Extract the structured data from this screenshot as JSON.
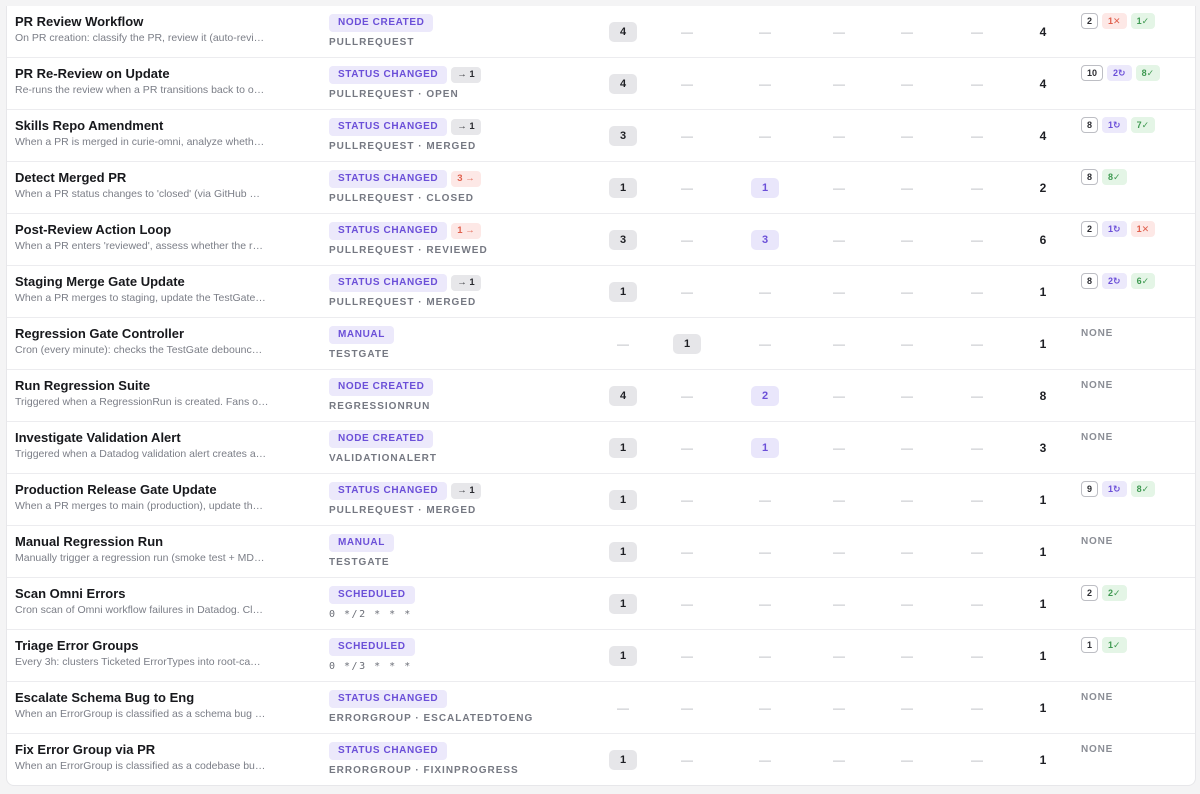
{
  "dash": "—",
  "none_label": "NONE",
  "workflows": [
    {
      "name": "PR Review Workflow",
      "desc": "On PR creation: classify the PR, review it (auto-revi…",
      "trigger": "NODE CREATED",
      "transition": "",
      "transition_style": "",
      "scope": "PULLREQUEST",
      "scope_mono": false,
      "counts": [
        {
          "v": "4",
          "s": "gray"
        },
        {
          "v": "—",
          "s": "dash"
        },
        {
          "v": "—",
          "s": "dash"
        },
        {
          "v": "—",
          "s": "dash"
        },
        {
          "v": "—",
          "s": "dash"
        },
        {
          "v": "—",
          "s": "dash"
        }
      ],
      "total": "4",
      "runs": [
        {
          "t": "2",
          "k": "count"
        },
        {
          "t": "1✕",
          "k": "red"
        },
        {
          "t": "1✓",
          "k": "green"
        }
      ]
    },
    {
      "name": "PR Re-Review on Update",
      "desc": "Re-runs the review when a PR transitions back to o…",
      "trigger": "STATUS CHANGED",
      "transition": "→ 1",
      "transition_style": "",
      "scope": "PULLREQUEST · OPEN",
      "scope_mono": false,
      "counts": [
        {
          "v": "4",
          "s": "gray"
        },
        {
          "v": "—",
          "s": "dash"
        },
        {
          "v": "—",
          "s": "dash"
        },
        {
          "v": "—",
          "s": "dash"
        },
        {
          "v": "—",
          "s": "dash"
        },
        {
          "v": "—",
          "s": "dash"
        }
      ],
      "total": "4",
      "runs": [
        {
          "t": "10",
          "k": "count"
        },
        {
          "t": "2↻",
          "k": "purple"
        },
        {
          "t": "8✓",
          "k": "green"
        }
      ]
    },
    {
      "name": "Skills Repo Amendment",
      "desc": "When a PR is merged in curie-omni, analyze wheth…",
      "trigger": "STATUS CHANGED",
      "transition": "→ 1",
      "transition_style": "",
      "scope": "PULLREQUEST · MERGED",
      "scope_mono": false,
      "counts": [
        {
          "v": "3",
          "s": "gray"
        },
        {
          "v": "—",
          "s": "dash"
        },
        {
          "v": "—",
          "s": "dash"
        },
        {
          "v": "—",
          "s": "dash"
        },
        {
          "v": "—",
          "s": "dash"
        },
        {
          "v": "—",
          "s": "dash"
        }
      ],
      "total": "4",
      "runs": [
        {
          "t": "8",
          "k": "count"
        },
        {
          "t": "1↻",
          "k": "purple"
        },
        {
          "t": "7✓",
          "k": "green"
        }
      ]
    },
    {
      "name": "Detect Merged PR",
      "desc": "When a PR status changes to 'closed' (via GitHub …",
      "trigger": "STATUS CHANGED",
      "transition": "3 →",
      "transition_style": "warn",
      "scope": "PULLREQUEST · CLOSED",
      "scope_mono": false,
      "counts": [
        {
          "v": "1",
          "s": "gray"
        },
        {
          "v": "—",
          "s": "dash"
        },
        {
          "v": "1",
          "s": "purple"
        },
        {
          "v": "—",
          "s": "dash"
        },
        {
          "v": "—",
          "s": "dash"
        },
        {
          "v": "—",
          "s": "dash"
        }
      ],
      "total": "2",
      "runs": [
        {
          "t": "8",
          "k": "count"
        },
        {
          "t": "8✓",
          "k": "green"
        }
      ]
    },
    {
      "name": "Post-Review Action Loop",
      "desc": "When a PR enters 'reviewed', assess whether the r…",
      "trigger": "STATUS CHANGED",
      "transition": "1 →",
      "transition_style": "warn",
      "scope": "PULLREQUEST · REVIEWED",
      "scope_mono": false,
      "counts": [
        {
          "v": "3",
          "s": "gray"
        },
        {
          "v": "—",
          "s": "dash"
        },
        {
          "v": "3",
          "s": "purple"
        },
        {
          "v": "—",
          "s": "dash"
        },
        {
          "v": "—",
          "s": "dash"
        },
        {
          "v": "—",
          "s": "dash"
        }
      ],
      "total": "6",
      "runs": [
        {
          "t": "2",
          "k": "count"
        },
        {
          "t": "1↻",
          "k": "purple"
        },
        {
          "t": "1✕",
          "k": "red"
        }
      ]
    },
    {
      "name": "Staging Merge Gate Update",
      "desc": "When a PR merges to staging, update the TestGate…",
      "trigger": "STATUS CHANGED",
      "transition": "→ 1",
      "transition_style": "",
      "scope": "PULLREQUEST · MERGED",
      "scope_mono": false,
      "counts": [
        {
          "v": "1",
          "s": "gray"
        },
        {
          "v": "—",
          "s": "dash"
        },
        {
          "v": "—",
          "s": "dash"
        },
        {
          "v": "—",
          "s": "dash"
        },
        {
          "v": "—",
          "s": "dash"
        },
        {
          "v": "—",
          "s": "dash"
        }
      ],
      "total": "1",
      "runs": [
        {
          "t": "8",
          "k": "count"
        },
        {
          "t": "2↻",
          "k": "purple"
        },
        {
          "t": "6✓",
          "k": "green"
        }
      ]
    },
    {
      "name": "Regression Gate Controller",
      "desc": "Cron (every minute): checks the TestGate debounc…",
      "trigger": "MANUAL",
      "transition": "",
      "transition_style": "",
      "scope": "TESTGATE",
      "scope_mono": false,
      "counts": [
        {
          "v": "—",
          "s": "dash"
        },
        {
          "v": "1",
          "s": "gray"
        },
        {
          "v": "—",
          "s": "dash"
        },
        {
          "v": "—",
          "s": "dash"
        },
        {
          "v": "—",
          "s": "dash"
        },
        {
          "v": "—",
          "s": "dash"
        }
      ],
      "total": "1",
      "runs": []
    },
    {
      "name": "Run Regression Suite",
      "desc": "Triggered when a RegressionRun is created. Fans o…",
      "trigger": "NODE CREATED",
      "transition": "",
      "transition_style": "",
      "scope": "REGRESSIONRUN",
      "scope_mono": false,
      "counts": [
        {
          "v": "4",
          "s": "gray"
        },
        {
          "v": "—",
          "s": "dash"
        },
        {
          "v": "2",
          "s": "purple"
        },
        {
          "v": "—",
          "s": "dash"
        },
        {
          "v": "—",
          "s": "dash"
        },
        {
          "v": "—",
          "s": "dash"
        }
      ],
      "total": "8",
      "runs": []
    },
    {
      "name": "Investigate Validation Alert",
      "desc": "Triggered when a Datadog validation alert creates a…",
      "trigger": "NODE CREATED",
      "transition": "",
      "transition_style": "",
      "scope": "VALIDATIONALERT",
      "scope_mono": false,
      "counts": [
        {
          "v": "1",
          "s": "gray"
        },
        {
          "v": "—",
          "s": "dash"
        },
        {
          "v": "1",
          "s": "purple"
        },
        {
          "v": "—",
          "s": "dash"
        },
        {
          "v": "—",
          "s": "dash"
        },
        {
          "v": "—",
          "s": "dash"
        }
      ],
      "total": "3",
      "runs": []
    },
    {
      "name": "Production Release Gate Update",
      "desc": "When a PR merges to main (production), update th…",
      "trigger": "STATUS CHANGED",
      "transition": "→ 1",
      "transition_style": "",
      "scope": "PULLREQUEST · MERGED",
      "scope_mono": false,
      "counts": [
        {
          "v": "1",
          "s": "gray"
        },
        {
          "v": "—",
          "s": "dash"
        },
        {
          "v": "—",
          "s": "dash"
        },
        {
          "v": "—",
          "s": "dash"
        },
        {
          "v": "—",
          "s": "dash"
        },
        {
          "v": "—",
          "s": "dash"
        }
      ],
      "total": "1",
      "runs": [
        {
          "t": "9",
          "k": "count"
        },
        {
          "t": "1↻",
          "k": "purple"
        },
        {
          "t": "8✓",
          "k": "green"
        }
      ]
    },
    {
      "name": "Manual Regression Run",
      "desc": "Manually trigger a regression run (smoke test + MD…",
      "trigger": "MANUAL",
      "transition": "",
      "transition_style": "",
      "scope": "TESTGATE",
      "scope_mono": false,
      "counts": [
        {
          "v": "1",
          "s": "gray"
        },
        {
          "v": "—",
          "s": "dash"
        },
        {
          "v": "—",
          "s": "dash"
        },
        {
          "v": "—",
          "s": "dash"
        },
        {
          "v": "—",
          "s": "dash"
        },
        {
          "v": "—",
          "s": "dash"
        }
      ],
      "total": "1",
      "runs": []
    },
    {
      "name": "Scan Omni Errors",
      "desc": "Cron scan of Omni workflow failures in Datadog. Cl…",
      "trigger": "SCHEDULED",
      "transition": "",
      "transition_style": "",
      "scope": "0 */2 * * *",
      "scope_mono": true,
      "counts": [
        {
          "v": "1",
          "s": "gray"
        },
        {
          "v": "—",
          "s": "dash"
        },
        {
          "v": "—",
          "s": "dash"
        },
        {
          "v": "—",
          "s": "dash"
        },
        {
          "v": "—",
          "s": "dash"
        },
        {
          "v": "—",
          "s": "dash"
        }
      ],
      "total": "1",
      "runs": [
        {
          "t": "2",
          "k": "count"
        },
        {
          "t": "2✓",
          "k": "green"
        }
      ]
    },
    {
      "name": "Triage Error Groups",
      "desc": "Every 3h: clusters Ticketed ErrorTypes into root-ca…",
      "trigger": "SCHEDULED",
      "transition": "",
      "transition_style": "",
      "scope": "0 */3 * * *",
      "scope_mono": true,
      "counts": [
        {
          "v": "1",
          "s": "gray"
        },
        {
          "v": "—",
          "s": "dash"
        },
        {
          "v": "—",
          "s": "dash"
        },
        {
          "v": "—",
          "s": "dash"
        },
        {
          "v": "—",
          "s": "dash"
        },
        {
          "v": "—",
          "s": "dash"
        }
      ],
      "total": "1",
      "runs": [
        {
          "t": "1",
          "k": "count"
        },
        {
          "t": "1✓",
          "k": "green"
        }
      ]
    },
    {
      "name": "Escalate Schema Bug to Eng",
      "desc": "When an ErrorGroup is classified as a schema bug …",
      "trigger": "STATUS CHANGED",
      "transition": "",
      "transition_style": "",
      "scope": "ERRORGROUP · ESCALATEDTOENG",
      "scope_mono": false,
      "counts": [
        {
          "v": "—",
          "s": "dash"
        },
        {
          "v": "—",
          "s": "dash"
        },
        {
          "v": "—",
          "s": "dash"
        },
        {
          "v": "—",
          "s": "dash"
        },
        {
          "v": "—",
          "s": "dash"
        },
        {
          "v": "—",
          "s": "dash"
        }
      ],
      "total": "1",
      "runs": []
    },
    {
      "name": "Fix Error Group via PR",
      "desc": "When an ErrorGroup is classified as a codebase bu…",
      "trigger": "STATUS CHANGED",
      "transition": "",
      "transition_style": "",
      "scope": "ERRORGROUP · FIXINPROGRESS",
      "scope_mono": false,
      "counts": [
        {
          "v": "1",
          "s": "gray"
        },
        {
          "v": "—",
          "s": "dash"
        },
        {
          "v": "—",
          "s": "dash"
        },
        {
          "v": "—",
          "s": "dash"
        },
        {
          "v": "—",
          "s": "dash"
        },
        {
          "v": "—",
          "s": "dash"
        }
      ],
      "total": "1",
      "runs": []
    }
  ]
}
